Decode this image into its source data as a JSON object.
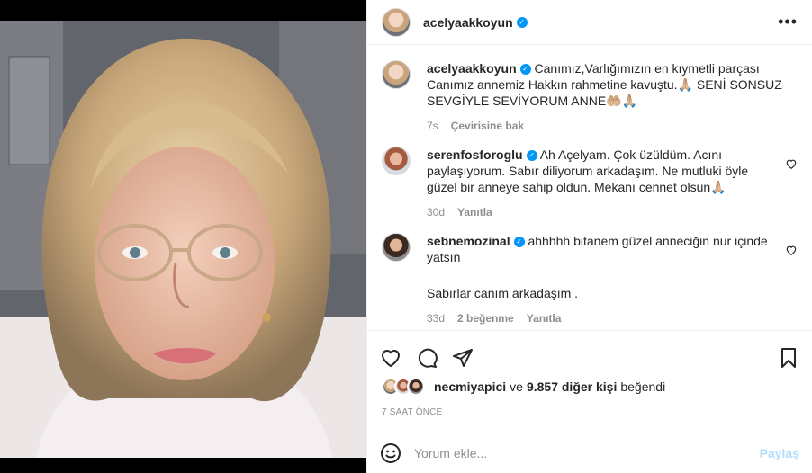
{
  "header": {
    "username": "acelyaakkoyun",
    "more_label": "•••"
  },
  "caption": {
    "username": "acelyaakkoyun",
    "text": "Canımız,Varlığımızın en kıymetli parçası Canımız annemiz Hakkın rahmetine kavuştu.🙏🏼 SENİ SONSUZ SEVGİYLE SEVİYORUM ANNE🤲🏼🙏🏼",
    "time": "7s",
    "translate": "Çevirisine bak"
  },
  "comments": [
    {
      "username": "serenfosforoglu",
      "text": "Ah Açelyam. Çok üzüldüm. Acını paylaşıyorum. Sabır diliyorum arkadaşım. Ne mutluki öyle güzel bir anneye sahip oldun. Mekanı cennet olsun🙏🏼",
      "time": "30d",
      "reply": "Yanıtla"
    },
    {
      "username": "sebnemozinal",
      "text": "ahhhhh bitanem güzel anneciğin nur içinde yatsın",
      "extra": "Sabırlar canım arkadaşım .",
      "time": "33d",
      "likes": "2 beğenme",
      "reply": "Yanıtla"
    }
  ],
  "likes": {
    "user": "necmiyapici",
    "mid": "ve",
    "count": "9.857 diğer kişi",
    "suffix": "beğendi"
  },
  "posted_ago": "7 SAAT ÖNCE",
  "comment_box": {
    "placeholder": "Yorum ekle...",
    "post_label": "Paylaş"
  },
  "icons": {
    "like": "heart-icon",
    "comment": "comment-icon",
    "share": "share-icon",
    "save": "bookmark-icon",
    "emoji": "emoji-icon"
  },
  "colors": {
    "verified": "#0095f6",
    "post_disabled": "#b2dffc",
    "muted": "#8e8e8e"
  }
}
